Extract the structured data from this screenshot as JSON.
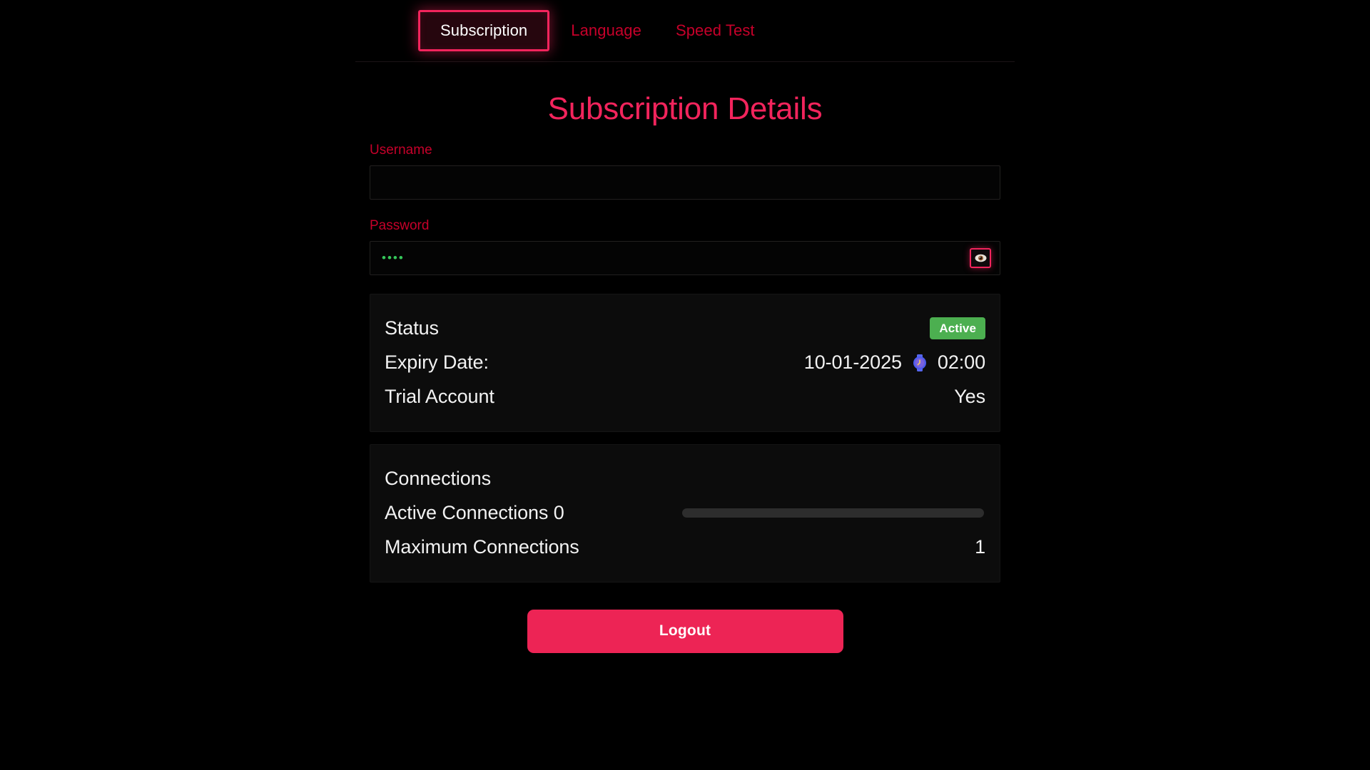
{
  "tabs": [
    {
      "label": "Subscription",
      "active": true
    },
    {
      "label": "Language",
      "active": false
    },
    {
      "label": "Speed Test",
      "active": false
    }
  ],
  "page": {
    "title": "Subscription Details"
  },
  "form": {
    "username": {
      "label": "Username",
      "value": "",
      "placeholder": ""
    },
    "password": {
      "label": "Password",
      "value": "••••",
      "placeholder": "",
      "masked_char_count": 4,
      "toggle_icon": "eye-icon"
    }
  },
  "status_card": {
    "rows": [
      {
        "label": "Status",
        "value": "Active",
        "type": "badge",
        "badge_color": "#4caf50"
      },
      {
        "label": "Expiry Date:",
        "value": "10-01-2025",
        "icon": "watch-icon",
        "time": "02:00",
        "type": "date"
      },
      {
        "label": "Trial Account",
        "value": "Yes",
        "type": "text"
      }
    ]
  },
  "connections_card": {
    "heading": "Connections",
    "active_label": "Active Connections 0",
    "active_count": 0,
    "progress_percent": 0,
    "maximum_label": "Maximum Connections",
    "maximum_value": "1"
  },
  "actions": {
    "logout_label": "Logout"
  },
  "colors": {
    "accent": "#f2245c",
    "accent_dark": "#c6002a",
    "logout": "#ed2455",
    "badge_green": "#4caf50",
    "password_text": "#35c75a",
    "background": "#000000",
    "card_background": "#0c0c0c",
    "progress_track": "#2d2d2d"
  }
}
